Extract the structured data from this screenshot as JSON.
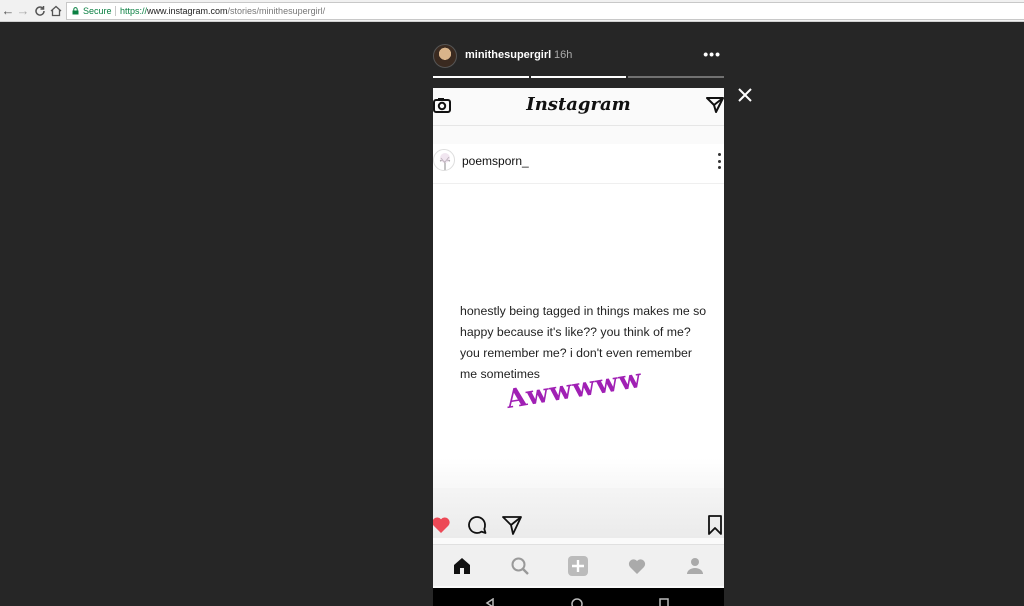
{
  "browser": {
    "secure_label": "Secure",
    "url_scheme": "https://",
    "url_host": "www.instagram.com",
    "url_path": "/stories/minithesupergirl/"
  },
  "story": {
    "username": "minithesupergirl",
    "time_ago": "16h",
    "more_label": "•••",
    "progress_segments": [
      true,
      true,
      false
    ]
  },
  "screenshot": {
    "app_logo": "Instagram",
    "post_username": "poemsporn_",
    "post_text": "honestly being tagged in things makes me so happy because it's like?? you think of me? you remember me? i don't even remember me sometimes",
    "overlay_text": "Awwwww",
    "like_color": "#ed4956",
    "accent_color": "#a020b4"
  }
}
